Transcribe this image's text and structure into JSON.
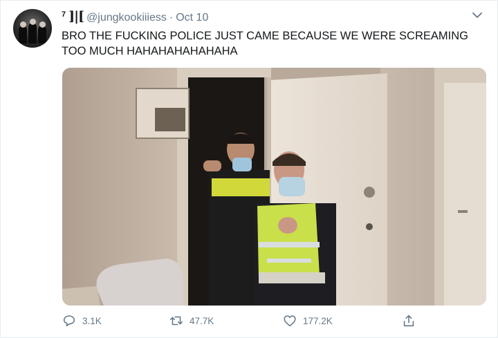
{
  "author": {
    "name_superscript": "7",
    "name_glyph": "]|[",
    "handle": "@jungkookiiiess",
    "separator": "·",
    "date": "Oct 10"
  },
  "tweet": {
    "text": "BRO THE FUCKING POLICE JUST CAME BECAUSE WE WERE SCREAMING TOO MUCH HAHAHAHAHAHAHA"
  },
  "icons": {
    "more": "chevron-down-icon",
    "reply": "reply-icon",
    "retweet": "retweet-icon",
    "like": "heart-icon",
    "share": "share-icon"
  },
  "stats": {
    "replies": "3.1K",
    "retweets": "47.7K",
    "likes": "177.2K"
  },
  "colors": {
    "secondary_text": "#657786",
    "primary_text": "#14171a",
    "border": "#e6ecf0"
  }
}
